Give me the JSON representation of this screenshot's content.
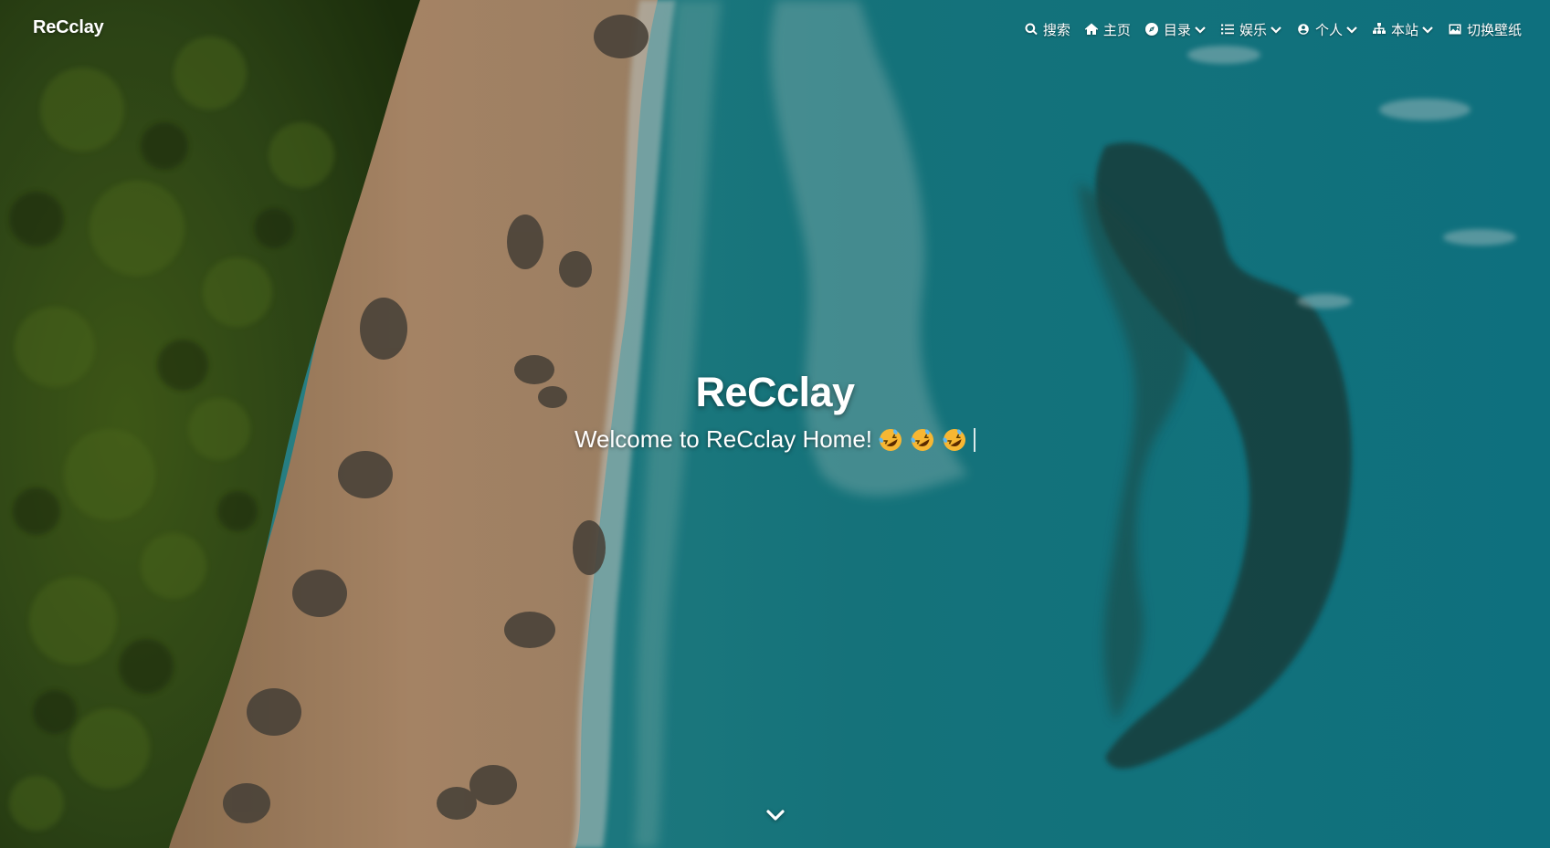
{
  "brand": "ReCclay",
  "nav": [
    {
      "label": "搜索",
      "icon": "search-icon",
      "dropdown": false
    },
    {
      "label": "主页",
      "icon": "home-icon",
      "dropdown": false
    },
    {
      "label": "目录",
      "icon": "compass-icon",
      "dropdown": true
    },
    {
      "label": "娱乐",
      "icon": "list-icon",
      "dropdown": true
    },
    {
      "label": "个人",
      "icon": "user-circle-icon",
      "dropdown": true
    },
    {
      "label": "本站",
      "icon": "sitemap-icon",
      "dropdown": true
    },
    {
      "label": "切换壁纸",
      "icon": "image-icon",
      "dropdown": false
    }
  ],
  "hero": {
    "title": "ReCclay",
    "subtitle": "Welcome to ReCclay Home!",
    "emoji": [
      "rolling-on-floor-laughing-emoji",
      "rolling-on-floor-laughing-emoji",
      "rolling-on-floor-laughing-emoji"
    ]
  },
  "scroll_down_icon": "chevron-down-icon",
  "background": "aerial-beach-forest-sea-photo",
  "colors": {
    "forest": "#2f4a14",
    "sand": "#c99e72",
    "shallow_water": "#2aa0a6",
    "deep_water": "#0f7f8a",
    "reef": "#1d4746",
    "text": "#ffffff"
  }
}
